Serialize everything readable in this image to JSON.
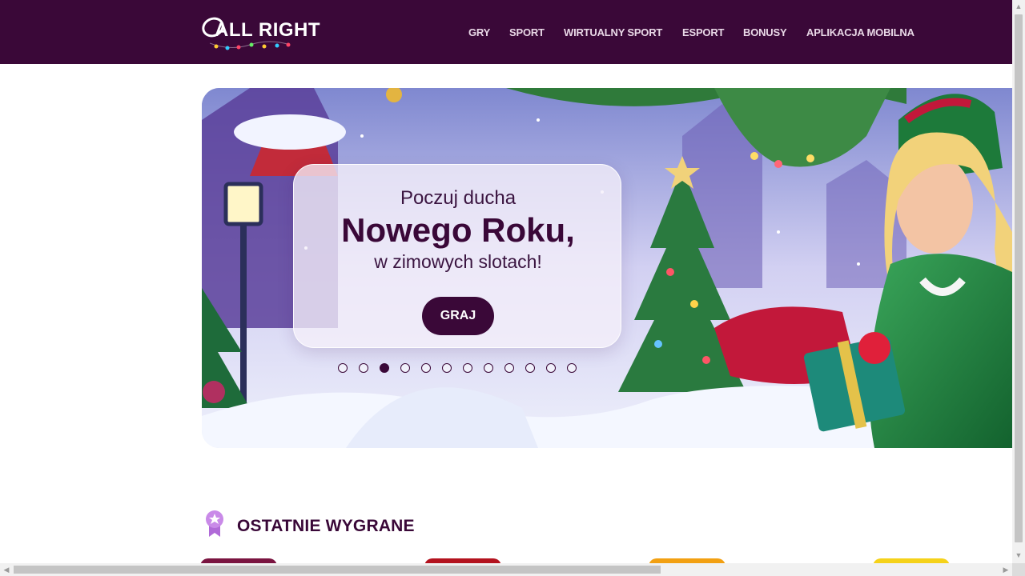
{
  "header": {
    "logo_text": "ALL RIGHT",
    "nav": [
      {
        "label": "GRY"
      },
      {
        "label": "SPORT"
      },
      {
        "label": "WIRTUALNY SPORT"
      },
      {
        "label": "ESPORT"
      },
      {
        "label": "BONUSY"
      },
      {
        "label": "APLIKACJA MOBILNA"
      }
    ]
  },
  "banner": {
    "line1": "Poczuj ducha",
    "line2": "Nowego Roku,",
    "line3": "w zimowych slotach!",
    "cta_label": "GRAJ",
    "slide_count": 12,
    "active_slide": 3
  },
  "recent_wins": {
    "title": "OSTATNIE WYGRANE",
    "card_colors": [
      "#7a1440",
      "#b3121e",
      "#f2a012",
      "#f5d21a"
    ]
  },
  "colors": {
    "brand": "#3a0838",
    "nav_text": "#e9d8e7"
  }
}
